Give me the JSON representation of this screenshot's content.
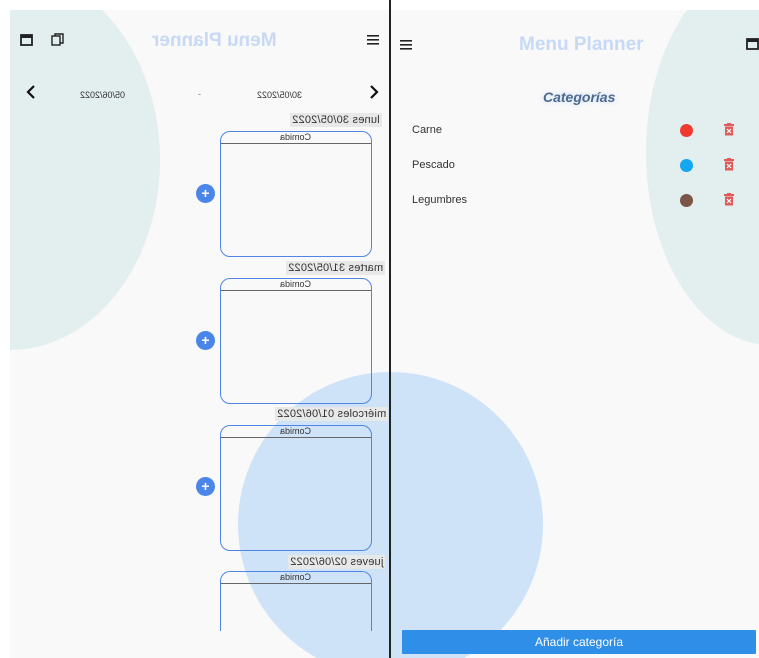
{
  "left_panel": {
    "title": "Menu Planner",
    "date_from": "30/05/2022",
    "date_separator": "-",
    "date_to": "05/06/2022",
    "days": [
      {
        "label": "lunes 30/05/2022",
        "meal": "Comida"
      },
      {
        "label": "martes 31/05/2022",
        "meal": "Comida"
      },
      {
        "label": "miércoles 01/06/2022",
        "meal": "Comida"
      },
      {
        "label": "jueves 02/06/2022",
        "meal": "Comida"
      }
    ],
    "add_symbol": "+",
    "icons": [
      "calendar-icon",
      "copy-icon",
      "menu-icon",
      "chevron-left-icon",
      "chevron-right-icon"
    ]
  },
  "right_panel": {
    "title": "Menu Planner",
    "section_title": "Categorías",
    "categories": [
      {
        "name": "Carne",
        "color": "#f13a2f"
      },
      {
        "name": "Pescado",
        "color": "#12a7f0"
      },
      {
        "name": "Legumbres",
        "color": "#7a5548"
      }
    ],
    "add_button": "Añadir categoría",
    "icons": [
      "menu-icon",
      "calendar-icon",
      "delete-icon"
    ]
  },
  "colors": {
    "accent": "#4a86ea",
    "button": "#2f8fe8",
    "title": "#c7d9f5",
    "delete": "#e05a5a",
    "bg_circle_blue": "#cfe3f8",
    "bg_circle_teal": "#e3eeee"
  }
}
